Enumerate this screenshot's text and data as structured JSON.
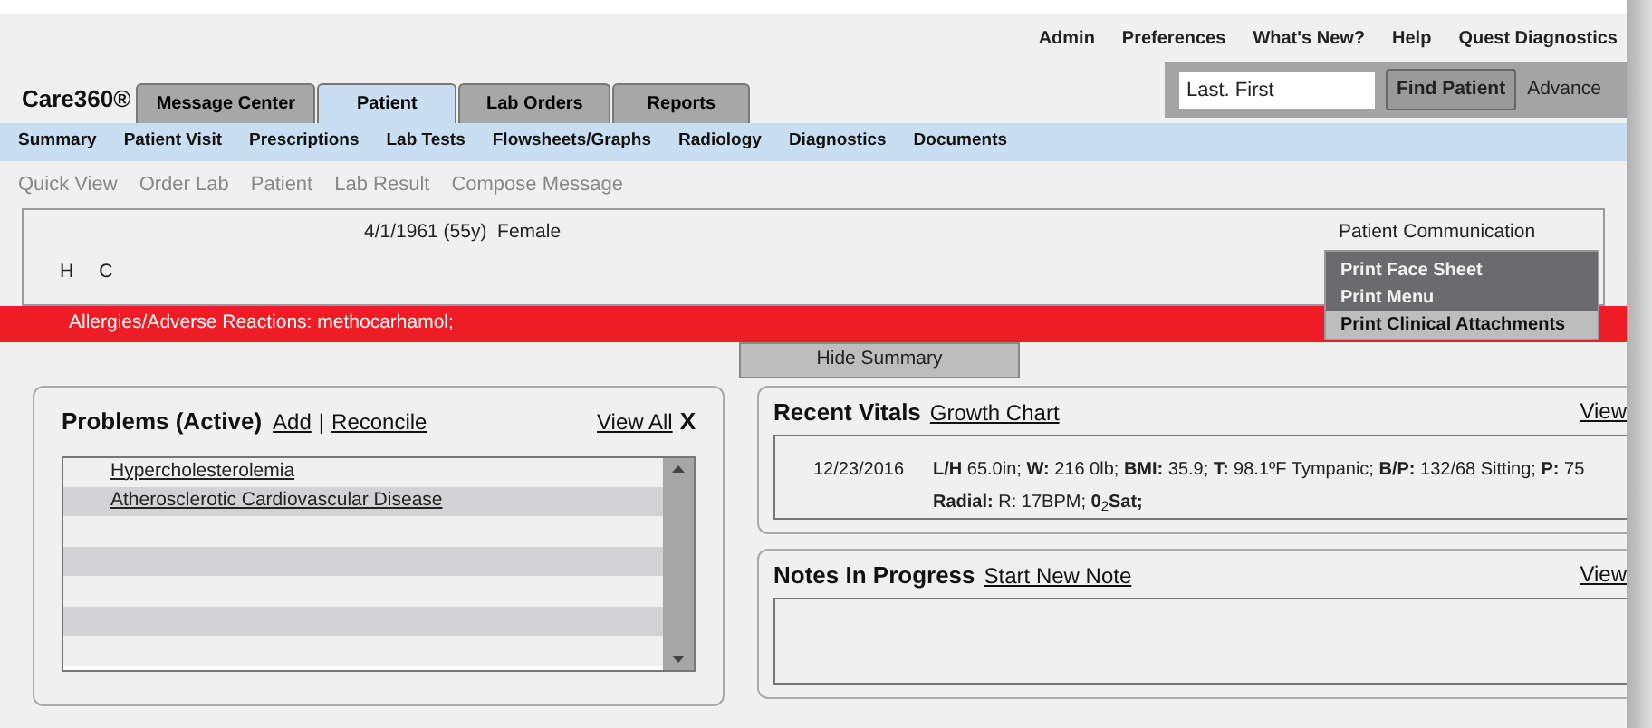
{
  "top_links": [
    "Admin",
    "Preferences",
    "What's New?",
    "Help",
    "Quest Diagnostics"
  ],
  "logo": "Care360®",
  "tabs": [
    {
      "label": "Message Center",
      "selected": false
    },
    {
      "label": "Patient",
      "selected": true
    },
    {
      "label": "Lab Orders",
      "selected": false
    },
    {
      "label": "Reports",
      "selected": false
    }
  ],
  "search": {
    "placeholder": "Last. First",
    "button": "Find Patient",
    "advanced": "Advance"
  },
  "nav": [
    "Summary",
    "Patient Visit",
    "Prescriptions",
    "Lab Tests",
    "Flowsheets/Graphs",
    "Radiology",
    "Diagnostics",
    "Documents"
  ],
  "quick_links": [
    "Quick View",
    "Order Lab",
    "Patient",
    "Lab Result",
    "Compose Message"
  ],
  "patient": {
    "dob": "4/1/1961 (55y)  Female",
    "initials": [
      "H",
      "C"
    ],
    "communication": "Patient Communication"
  },
  "print_menu": [
    {
      "label": "Print Face Sheet",
      "selected": false
    },
    {
      "label": "Print Menu",
      "selected": false
    },
    {
      "label": "Print Clinical Attachments",
      "selected": true
    }
  ],
  "allergies": "Allergies/Adverse Reactions: methocarhamol;",
  "hide_summary": "Hide Summary",
  "problems": {
    "title": "Problems (Active)",
    "add": "Add",
    "separator": "|",
    "reconcile": "Reconcile",
    "view_all": "View All",
    "close": "X",
    "items": [
      "Hypercholesterolemia",
      "Atherosclerotic Cardiovascular Disease"
    ]
  },
  "vitals": {
    "title": "Recent Vitals",
    "link": "Growth Chart",
    "view": "View",
    "date": "12/23/2016",
    "text": "**L/H** 65.0in; **W:** 216 0lb;  **BMI:** 35.9; **T:** 98.1ºF Tympanic; **B/P:** 132/68 Sitting; **P:** 75 **Radial:** R: 17BPM;  **0**$_{2}$**Sat;**"
  },
  "notes": {
    "title": "Notes In Progress",
    "link": "Start New Note",
    "view": "View"
  }
}
